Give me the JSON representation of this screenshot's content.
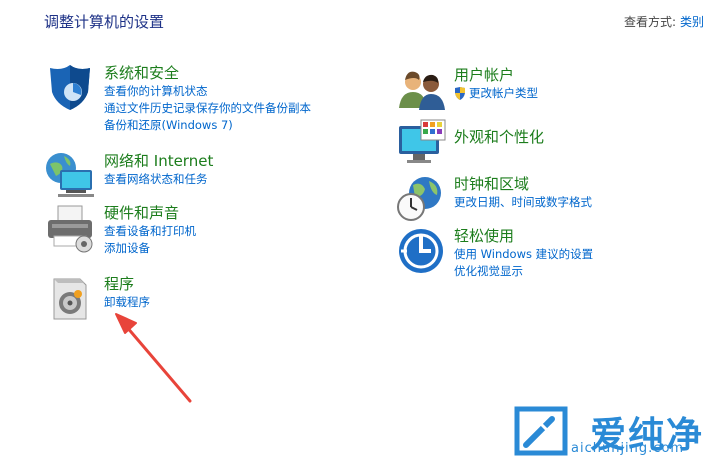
{
  "header": {
    "title": "调整计算机的设置",
    "view_by_label": "查看方式:",
    "view_by_value": "类别"
  },
  "categories": [
    {
      "title": "系统和安全",
      "icon": "shield-icon",
      "links": [
        "查看你的计算机状态",
        "通过文件历史记录保存你的文件备份副本",
        "备份和还原(Windows 7)"
      ]
    },
    {
      "title": "网络和 Internet",
      "icon": "network-globe-icon",
      "links": [
        "查看网络状态和任务"
      ]
    },
    {
      "title": "硬件和声音",
      "icon": "printer-icon",
      "links": [
        "查看设备和打印机",
        "添加设备"
      ]
    },
    {
      "title": "程序",
      "icon": "programs-disc-icon",
      "links": [
        "卸载程序"
      ]
    },
    {
      "title": "用户帐户",
      "icon": "users-icon",
      "links": [
        "更改帐户类型"
      ]
    },
    {
      "title": "外观和个性化",
      "icon": "monitor-palette-icon",
      "links": []
    },
    {
      "title": "时钟和区域",
      "icon": "clock-globe-icon",
      "links": [
        "更改日期、时间或数字格式"
      ]
    },
    {
      "title": "轻松使用",
      "icon": "ease-of-access-icon",
      "links": [
        "使用 Windows 建议的设置",
        "优化视觉显示"
      ]
    }
  ],
  "watermark": {
    "text": "爱纯净",
    "url": "aichunjing.com"
  },
  "colors": {
    "category_title": "#1c7d1c",
    "link": "#0066cc",
    "page_title": "#1e3287",
    "annotation_arrow": "#e8443a",
    "watermark": "#2a8ad6"
  }
}
